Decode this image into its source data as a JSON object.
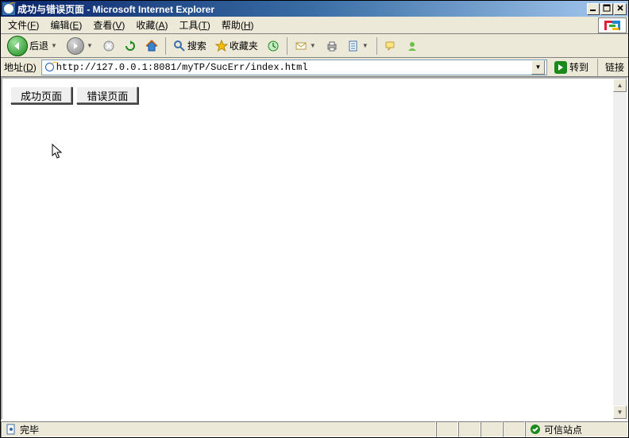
{
  "titlebar": {
    "title": "成功与错误页面 - Microsoft Internet Explorer"
  },
  "menubar": {
    "file": {
      "label": "文件",
      "accel": "F"
    },
    "edit": {
      "label": "编辑",
      "accel": "E"
    },
    "view": {
      "label": "查看",
      "accel": "V"
    },
    "fav": {
      "label": "收藏",
      "accel": "A"
    },
    "tools": {
      "label": "工具",
      "accel": "T"
    },
    "help": {
      "label": "帮助",
      "accel": "H"
    }
  },
  "toolbar": {
    "back_label": "后退",
    "search_label": "搜索",
    "favorites_label": "收藏夹"
  },
  "addressbar": {
    "label": "地址",
    "accel": "D",
    "url": "http://127.0.0.1:8081/myTP/SucErr/index.html",
    "go_label": "转到",
    "links_label": "链接"
  },
  "page": {
    "success_btn": "成功页面",
    "error_btn": "错误页面"
  },
  "statusbar": {
    "done": "完毕",
    "zone": "可信站点"
  }
}
